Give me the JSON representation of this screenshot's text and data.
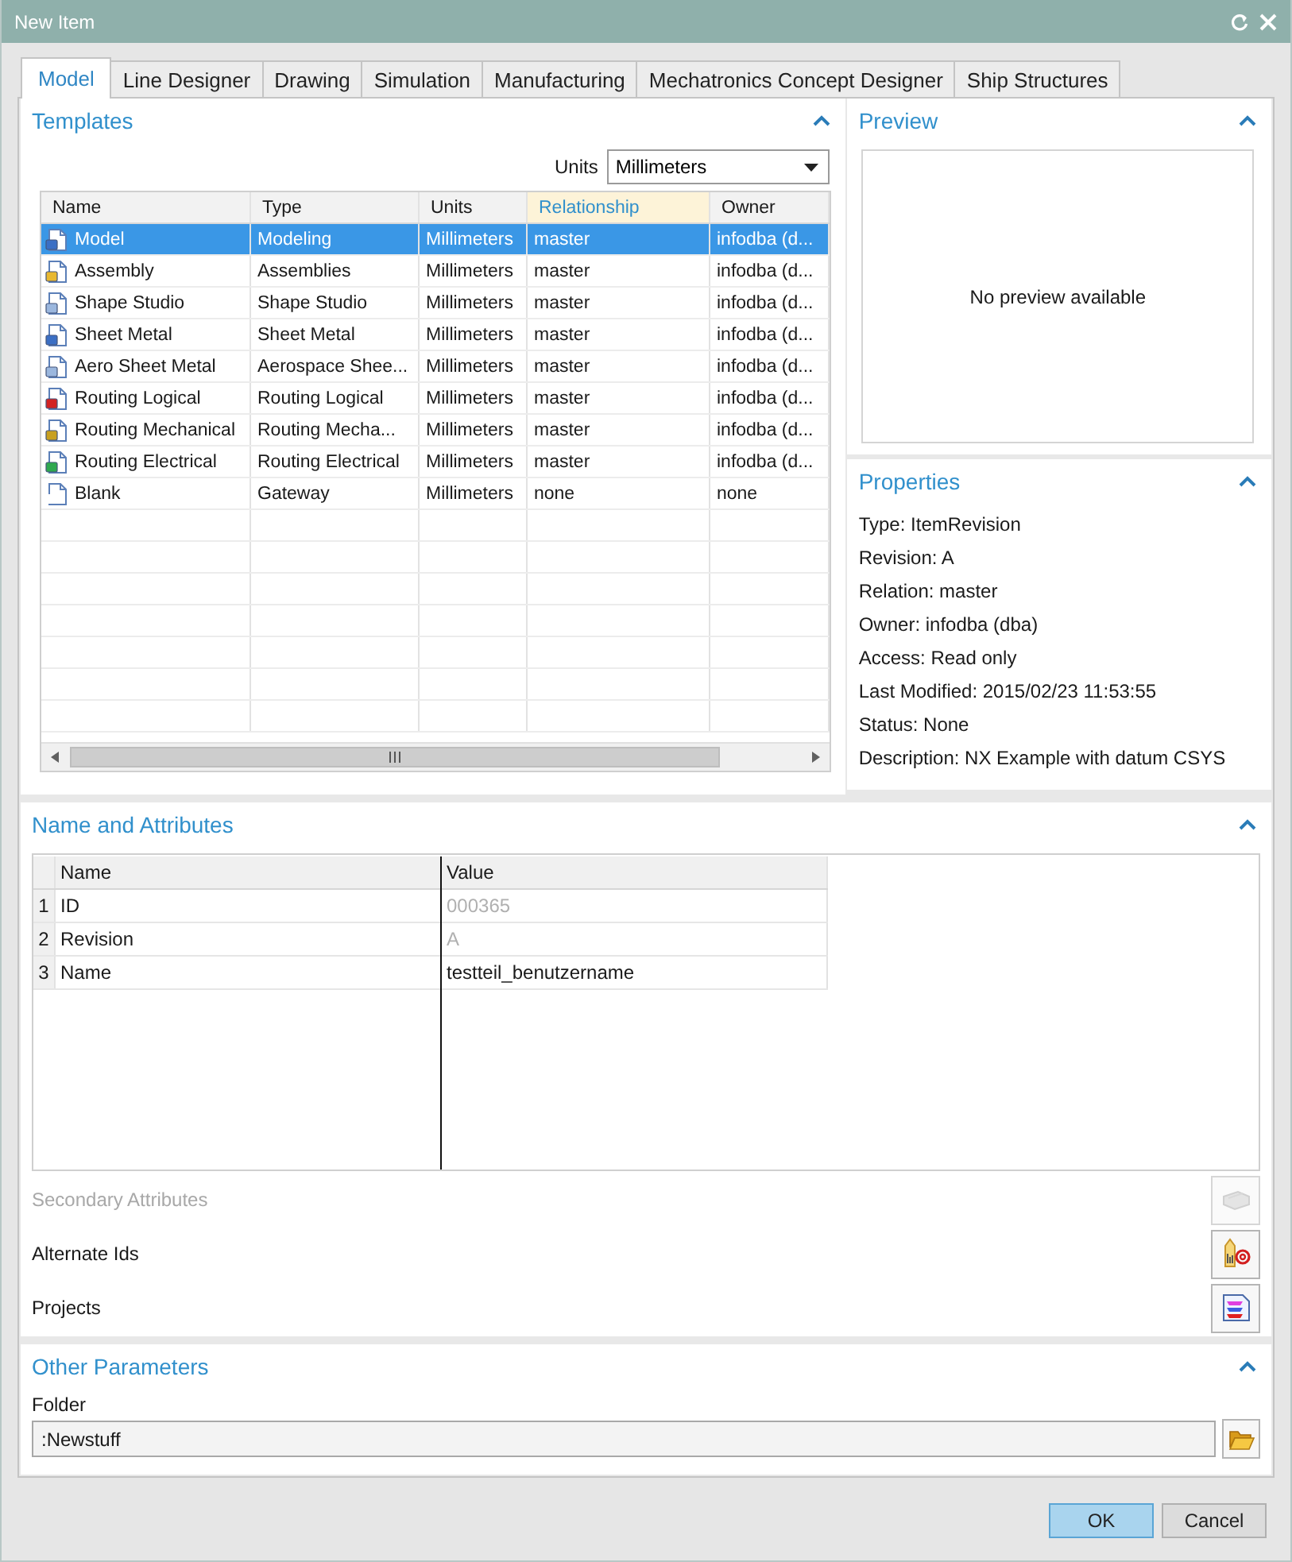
{
  "window": {
    "title": "New Item"
  },
  "tabs": [
    {
      "label": "Model",
      "selected": true
    },
    {
      "label": "Line Designer",
      "selected": false
    },
    {
      "label": "Drawing",
      "selected": false
    },
    {
      "label": "Simulation",
      "selected": false
    },
    {
      "label": "Manufacturing",
      "selected": false
    },
    {
      "label": "Mechatronics Concept Designer",
      "selected": false
    },
    {
      "label": "Ship Structures",
      "selected": false
    }
  ],
  "templates": {
    "title": "Templates",
    "expanded": true,
    "units_label": "Units",
    "units_value": "Millimeters",
    "columns": [
      {
        "label": "Name",
        "sorted": false
      },
      {
        "label": "Type",
        "sorted": false
      },
      {
        "label": "Units",
        "sorted": false
      },
      {
        "label": "Relationship",
        "sorted": true
      },
      {
        "label": "Owner",
        "sorted": false
      }
    ],
    "rows": [
      {
        "cells": [
          "Model",
          "Modeling",
          "Millimeters",
          "master",
          "infodba (d..."
        ],
        "selected": true
      },
      {
        "cells": [
          "Assembly",
          "Assemblies",
          "Millimeters",
          "master",
          "infodba (d..."
        ],
        "selected": false
      },
      {
        "cells": [
          "Shape Studio",
          "Shape Studio",
          "Millimeters",
          "master",
          "infodba (d..."
        ],
        "selected": false
      },
      {
        "cells": [
          "Sheet Metal",
          "Sheet Metal",
          "Millimeters",
          "master",
          "infodba (d..."
        ],
        "selected": false
      },
      {
        "cells": [
          "Aero Sheet Metal",
          "Aerospace Shee...",
          "Millimeters",
          "master",
          "infodba (d..."
        ],
        "selected": false
      },
      {
        "cells": [
          "Routing Logical",
          "Routing Logical",
          "Millimeters",
          "master",
          "infodba (d..."
        ],
        "selected": false
      },
      {
        "cells": [
          "Routing Mechanical",
          "Routing Mecha...",
          "Millimeters",
          "master",
          "infodba (d..."
        ],
        "selected": false
      },
      {
        "cells": [
          "Routing Electrical",
          "Routing Electrical",
          "Millimeters",
          "master",
          "infodba (d..."
        ],
        "selected": false
      },
      {
        "cells": [
          "Blank",
          "Gateway",
          "Millimeters",
          "none",
          "none"
        ],
        "selected": false
      }
    ]
  },
  "preview": {
    "title": "Preview",
    "expanded": true,
    "message": "No preview available"
  },
  "properties": {
    "title": "Properties",
    "expanded": true,
    "lines": [
      "Type: ItemRevision",
      "Revision: A",
      "Relation: master",
      "Owner: infodba (dba)",
      "Access: Read only",
      "Last Modified: 2015/02/23 11:53:55",
      "Status: None",
      "Description: NX Example with datum CSYS"
    ]
  },
  "name_and_attributes": {
    "title": "Name and Attributes",
    "expanded": true,
    "columns": [
      "Name",
      "Value"
    ],
    "rows": [
      {
        "index": "1",
        "name": "ID",
        "value": "000365",
        "disabled": true
      },
      {
        "index": "2",
        "name": "Revision",
        "value": "A",
        "disabled": true
      },
      {
        "index": "3",
        "name": "Name",
        "value": "testteil_benutzername",
        "disabled": false
      }
    ],
    "options": [
      {
        "label": "Secondary Attributes",
        "disabled": true
      },
      {
        "label": "Alternate Ids",
        "disabled": false
      },
      {
        "label": "Projects",
        "disabled": false
      }
    ]
  },
  "other_parameters": {
    "title": "Other Parameters",
    "expanded": true,
    "folder_label": "Folder",
    "folder_value": ":Newstuff"
  },
  "buttons": [
    {
      "label": "OK",
      "default": true
    },
    {
      "label": "Cancel",
      "default": false
    }
  ]
}
